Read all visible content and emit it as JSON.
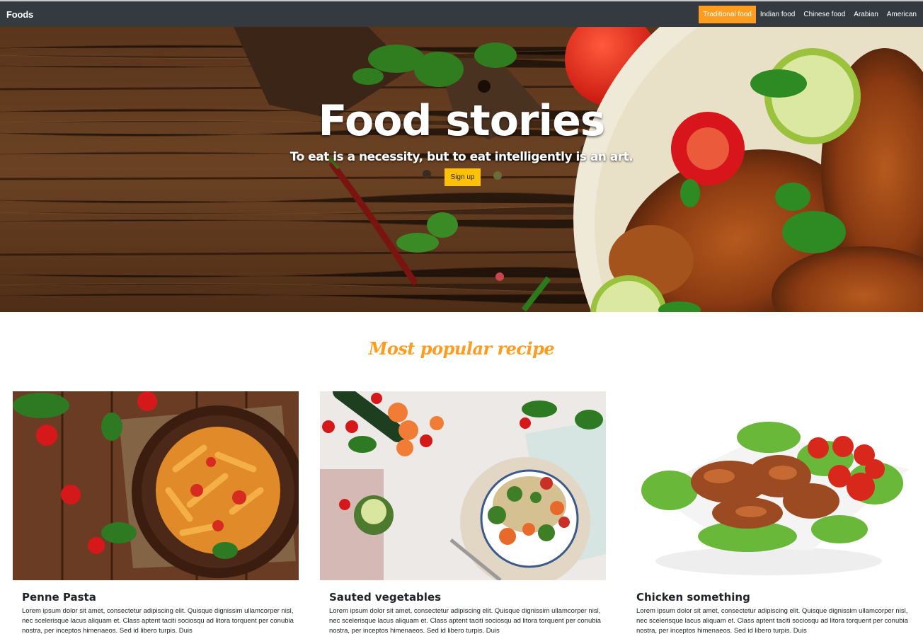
{
  "navbar": {
    "brand": "Foods",
    "items": [
      {
        "label": "Traditional food",
        "active": true
      },
      {
        "label": "Indian food",
        "active": false
      },
      {
        "label": "Chinese food",
        "active": false
      },
      {
        "label": "Arabian",
        "active": false
      },
      {
        "label": "American",
        "active": false
      }
    ]
  },
  "hero": {
    "title": "Food stories",
    "subtitle": "To eat is a necessity, but to eat intelligently is an art.",
    "button_label": "Sign up"
  },
  "section": {
    "title": "Most popular recipe"
  },
  "cards": [
    {
      "title": "Penne Pasta",
      "text": "Lorem ipsum dolor sit amet, consectetur adipiscing elit. Quisque dignissim ullamcorper nisl, nec scelerisque lacus aliquam et. Class aptent taciti sociosqu ad litora torquent per conubia nostra, per inceptos himenaeos. Sed id libero turpis. Duis"
    },
    {
      "title": "Sauted vegetables",
      "text": "Lorem ipsum dolor sit amet, consectetur adipiscing elit. Quisque dignissim ullamcorper nisl, nec scelerisque lacus aliquam et. Class aptent taciti sociosqu ad litora torquent per conubia nostra, per inceptos himenaeos. Sed id libero turpis. Duis"
    },
    {
      "title": "Chicken something",
      "text": "Lorem ipsum dolor sit amet, consectetur adipiscing elit. Quisque dignissim ullamcorper nisl, nec scelerisque lacus aliquam et. Class aptent taciti sociosqu ad litora torquent per conubia nostra, per inceptos himenaeos. Sed id libero turpis. Duis"
    }
  ],
  "colors": {
    "navbar_bg": "#343a40",
    "accent": "#fd9c1f",
    "button": "#ffc107"
  }
}
